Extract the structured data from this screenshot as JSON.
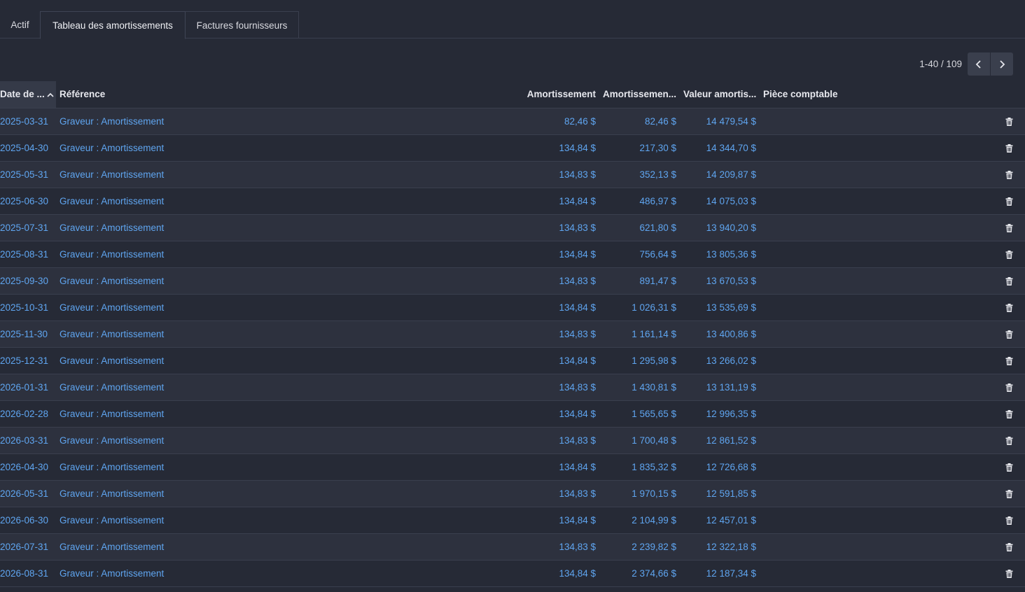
{
  "tabs": [
    {
      "label": "Actif",
      "active": false
    },
    {
      "label": "Tableau des amortissements",
      "active": true
    },
    {
      "label": "Factures fournisseurs",
      "active": false
    }
  ],
  "pager": {
    "value": "1-40 / 109"
  },
  "table": {
    "headers": {
      "date": "Date de ...",
      "reference": "Référence",
      "amortissement": "Amortissement",
      "cumul": "Amortissemen...",
      "valeur": "Valeur amortis...",
      "piece": "Pièce comptable"
    },
    "sort": {
      "column": "date",
      "direction": "ascending"
    },
    "rows": [
      {
        "date": "2025-03-31",
        "reference": "Graveur : Amortissement",
        "amortissement": "82,46 $",
        "cumul": "82,46 $",
        "valeur": "14 479,54 $",
        "piece": ""
      },
      {
        "date": "2025-04-30",
        "reference": "Graveur : Amortissement",
        "amortissement": "134,84 $",
        "cumul": "217,30 $",
        "valeur": "14 344,70 $",
        "piece": ""
      },
      {
        "date": "2025-05-31",
        "reference": "Graveur : Amortissement",
        "amortissement": "134,83 $",
        "cumul": "352,13 $",
        "valeur": "14 209,87 $",
        "piece": ""
      },
      {
        "date": "2025-06-30",
        "reference": "Graveur : Amortissement",
        "amortissement": "134,84 $",
        "cumul": "486,97 $",
        "valeur": "14 075,03 $",
        "piece": ""
      },
      {
        "date": "2025-07-31",
        "reference": "Graveur : Amortissement",
        "amortissement": "134,83 $",
        "cumul": "621,80 $",
        "valeur": "13 940,20 $",
        "piece": ""
      },
      {
        "date": "2025-08-31",
        "reference": "Graveur : Amortissement",
        "amortissement": "134,84 $",
        "cumul": "756,64 $",
        "valeur": "13 805,36 $",
        "piece": ""
      },
      {
        "date": "2025-09-30",
        "reference": "Graveur : Amortissement",
        "amortissement": "134,83 $",
        "cumul": "891,47 $",
        "valeur": "13 670,53 $",
        "piece": ""
      },
      {
        "date": "2025-10-31",
        "reference": "Graveur : Amortissement",
        "amortissement": "134,84 $",
        "cumul": "1 026,31 $",
        "valeur": "13 535,69 $",
        "piece": ""
      },
      {
        "date": "2025-11-30",
        "reference": "Graveur : Amortissement",
        "amortissement": "134,83 $",
        "cumul": "1 161,14 $",
        "valeur": "13 400,86 $",
        "piece": ""
      },
      {
        "date": "2025-12-31",
        "reference": "Graveur : Amortissement",
        "amortissement": "134,84 $",
        "cumul": "1 295,98 $",
        "valeur": "13 266,02 $",
        "piece": ""
      },
      {
        "date": "2026-01-31",
        "reference": "Graveur : Amortissement",
        "amortissement": "134,83 $",
        "cumul": "1 430,81 $",
        "valeur": "13 131,19 $",
        "piece": ""
      },
      {
        "date": "2026-02-28",
        "reference": "Graveur : Amortissement",
        "amortissement": "134,84 $",
        "cumul": "1 565,65 $",
        "valeur": "12 996,35 $",
        "piece": ""
      },
      {
        "date": "2026-03-31",
        "reference": "Graveur : Amortissement",
        "amortissement": "134,83 $",
        "cumul": "1 700,48 $",
        "valeur": "12 861,52 $",
        "piece": ""
      },
      {
        "date": "2026-04-30",
        "reference": "Graveur : Amortissement",
        "amortissement": "134,84 $",
        "cumul": "1 835,32 $",
        "valeur": "12 726,68 $",
        "piece": ""
      },
      {
        "date": "2026-05-31",
        "reference": "Graveur : Amortissement",
        "amortissement": "134,83 $",
        "cumul": "1 970,15 $",
        "valeur": "12 591,85 $",
        "piece": ""
      },
      {
        "date": "2026-06-30",
        "reference": "Graveur : Amortissement",
        "amortissement": "134,84 $",
        "cumul": "2 104,99 $",
        "valeur": "12 457,01 $",
        "piece": ""
      },
      {
        "date": "2026-07-31",
        "reference": "Graveur : Amortissement",
        "amortissement": "134,83 $",
        "cumul": "2 239,82 $",
        "valeur": "12 322,18 $",
        "piece": ""
      },
      {
        "date": "2026-08-31",
        "reference": "Graveur : Amortissement",
        "amortissement": "134,84 $",
        "cumul": "2 374,66 $",
        "valeur": "12 187,34 $",
        "piece": ""
      }
    ]
  },
  "icons": {
    "pager_prev": "chevron-left-icon",
    "pager_next": "chevron-right-icon",
    "row_delete": "trash-icon",
    "sort": "chevron-up-icon"
  },
  "colors": {
    "background": "#262a36",
    "row_alt": "#2d313e",
    "link": "#5fa5f0",
    "border": "#3a3f4e"
  }
}
